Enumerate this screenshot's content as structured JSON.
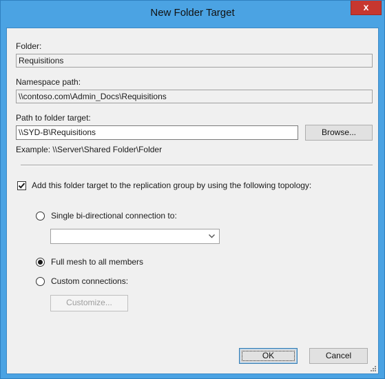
{
  "window": {
    "title": "New Folder Target",
    "close_glyph": "x"
  },
  "folder": {
    "label": "Folder:",
    "value": "Requisitions"
  },
  "namespace": {
    "label": "Namespace path:",
    "value": "\\\\contoso.com\\Admin_Docs\\Requisitions"
  },
  "target": {
    "label": "Path to folder target:",
    "value": "\\\\SYD-B\\Requisitions",
    "browse_label": "Browse...",
    "example": "Example: \\\\Server\\Shared Folder\\Folder"
  },
  "replication": {
    "checkbox_label": "Add this folder target to the replication group by using the following topology:",
    "checked": true,
    "options": [
      {
        "label": "Single bi-directional connection to:",
        "selected": false
      },
      {
        "label": "Full mesh to all members",
        "selected": true
      },
      {
        "label": "Custom connections:",
        "selected": false
      }
    ],
    "member_combo_value": "",
    "customize_label": "Customize..."
  },
  "buttons": {
    "ok": "OK",
    "cancel": "Cancel"
  },
  "icons": {
    "close": "close-icon",
    "chevron": "chevron-down-icon",
    "check": "checkmark-icon",
    "grip": "resize-grip-icon"
  },
  "colors": {
    "title_bar": "#4ba3e3",
    "close_button": "#c7372f",
    "client": "#f0f0f0"
  }
}
